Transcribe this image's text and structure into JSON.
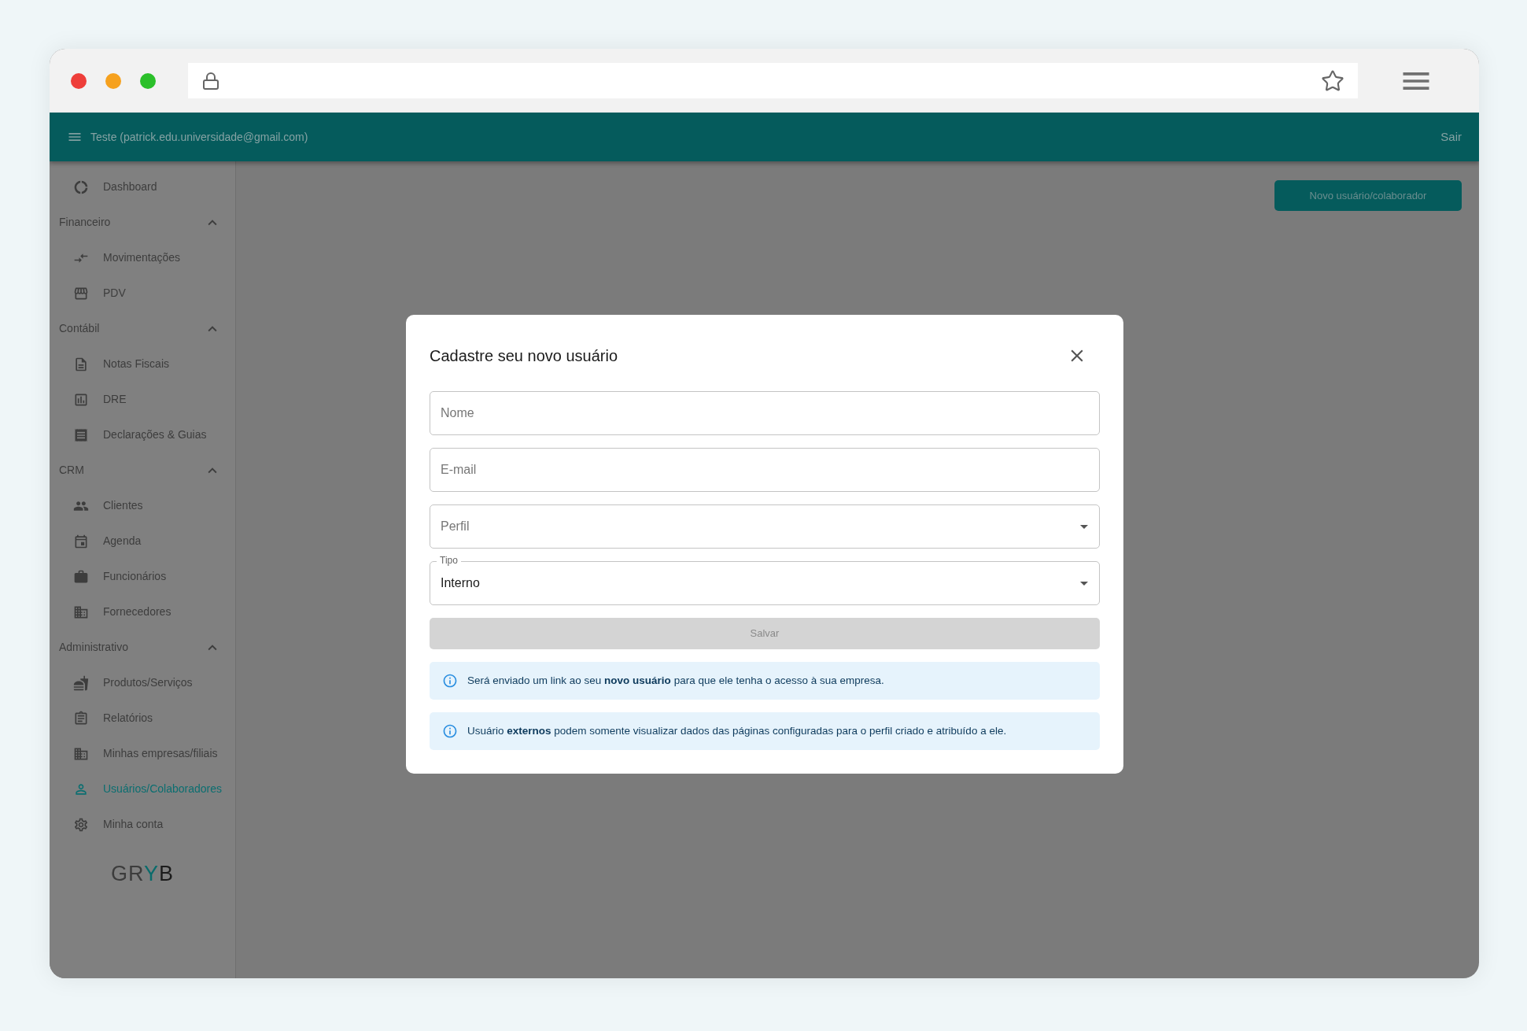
{
  "header": {
    "account": "Teste (patrick.edu.universidade@gmail.com)",
    "logout": "Sair"
  },
  "sidebar": {
    "items": [
      {
        "kind": "link",
        "label": "Dashboard",
        "selected": false
      },
      {
        "kind": "section",
        "label": "Financeiro",
        "expanded": true,
        "children": [
          {
            "label": "Movimentações",
            "selected": false
          },
          {
            "label": "PDV",
            "selected": false
          }
        ]
      },
      {
        "kind": "section",
        "label": "Contábil",
        "expanded": true,
        "children": [
          {
            "label": "Notas Fiscais",
            "selected": false
          },
          {
            "label": "DRE",
            "selected": false
          },
          {
            "label": "Declarações & Guias",
            "selected": false
          }
        ]
      },
      {
        "kind": "section",
        "label": "CRM",
        "expanded": true,
        "children": [
          {
            "label": "Clientes",
            "selected": false
          },
          {
            "label": "Agenda",
            "selected": false
          },
          {
            "label": "Funcionários",
            "selected": false
          },
          {
            "label": "Fornecedores",
            "selected": false
          }
        ]
      },
      {
        "kind": "section",
        "label": "Administrativo",
        "expanded": true,
        "children": [
          {
            "label": "Produtos/Serviços",
            "selected": false
          },
          {
            "label": "Relatórios",
            "selected": false
          },
          {
            "label": "Minhas empresas/filiais",
            "selected": false
          },
          {
            "label": "Usuários/Colaboradores",
            "selected": true
          },
          {
            "label": "Minha conta",
            "selected": false
          }
        ]
      }
    ],
    "logo": [
      {
        "text": "GR",
        "color": "#3c3c3c"
      },
      {
        "text": "Y",
        "color": "#0b6b6b"
      },
      {
        "text": "B",
        "color": "#1c1c1c"
      }
    ]
  },
  "main": {
    "new_button": "Novo usuário/colaborador"
  },
  "dialog": {
    "title": "Cadastre seu novo usuário",
    "fields": [
      {
        "kind": "text",
        "placeholder": "Nome"
      },
      {
        "kind": "text",
        "placeholder": "E-mail"
      },
      {
        "kind": "select",
        "placeholder": "Perfil"
      },
      {
        "kind": "select",
        "label": "Tipo",
        "value": "Interno"
      }
    ],
    "save": {
      "label": "Salvar",
      "disabled": true
    },
    "alerts": [
      "Será enviado um link ao seu **novo usuário** para que ele tenha o acesso à sua empresa.",
      "Usuário **externos** podem somente visualizar dados das páginas configuradas para o perfil criado e atribuído a ele."
    ]
  }
}
